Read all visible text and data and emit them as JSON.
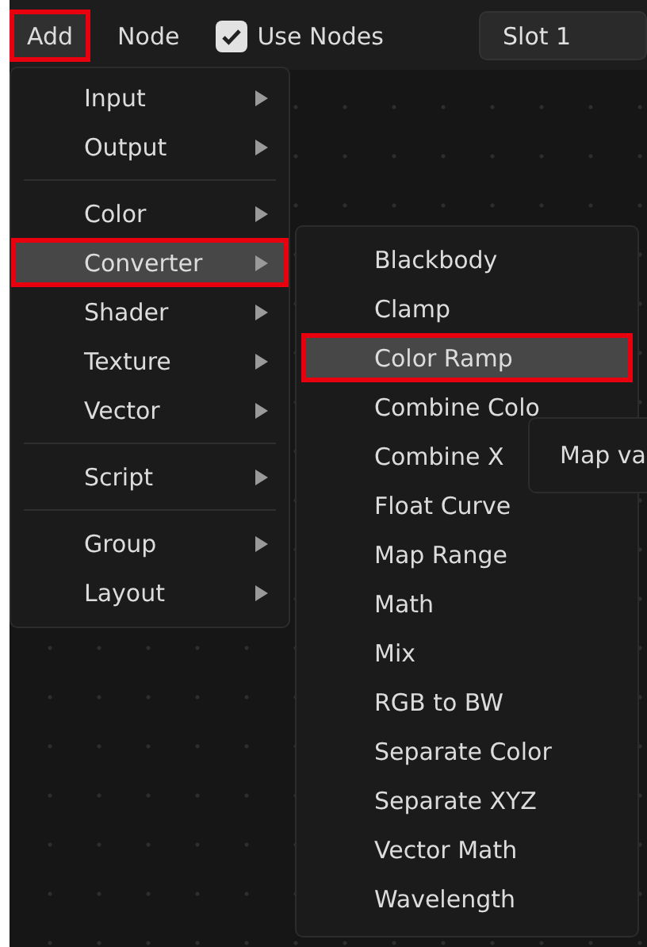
{
  "header": {
    "menus": [
      {
        "label": "Add",
        "selected": true,
        "highlighted": true
      },
      {
        "label": "Node",
        "selected": false,
        "highlighted": false
      }
    ],
    "use_nodes": {
      "label": "Use Nodes",
      "checked": true
    },
    "slot": {
      "value": "Slot 1"
    }
  },
  "add_menu": {
    "items": [
      {
        "kind": "submenu",
        "label": "Input",
        "selected": false,
        "highlighted": false
      },
      {
        "kind": "submenu",
        "label": "Output",
        "selected": false,
        "highlighted": false
      },
      {
        "kind": "separator"
      },
      {
        "kind": "submenu",
        "label": "Color",
        "selected": false,
        "highlighted": false
      },
      {
        "kind": "submenu",
        "label": "Converter",
        "selected": true,
        "highlighted": true
      },
      {
        "kind": "submenu",
        "label": "Shader",
        "selected": false,
        "highlighted": false
      },
      {
        "kind": "submenu",
        "label": "Texture",
        "selected": false,
        "highlighted": false
      },
      {
        "kind": "submenu",
        "label": "Vector",
        "selected": false,
        "highlighted": false
      },
      {
        "kind": "separator"
      },
      {
        "kind": "submenu",
        "label": "Script",
        "selected": false,
        "highlighted": false
      },
      {
        "kind": "separator"
      },
      {
        "kind": "submenu",
        "label": "Group",
        "selected": false,
        "highlighted": false
      },
      {
        "kind": "submenu",
        "label": "Layout",
        "selected": false,
        "highlighted": false
      }
    ]
  },
  "converter_menu": {
    "items": [
      {
        "kind": "item",
        "label": "Blackbody",
        "selected": false,
        "highlighted": false
      },
      {
        "kind": "item",
        "label": "Clamp",
        "selected": false,
        "highlighted": false
      },
      {
        "kind": "item",
        "label": "Color Ramp",
        "selected": true,
        "highlighted": true
      },
      {
        "kind": "item",
        "label": "Combine Colo",
        "selected": false,
        "highlighted": false
      },
      {
        "kind": "item",
        "label": "Combine X",
        "selected": false,
        "highlighted": false
      },
      {
        "kind": "item",
        "label": "Float Curve",
        "selected": false,
        "highlighted": false
      },
      {
        "kind": "item",
        "label": "Map Range",
        "selected": false,
        "highlighted": false
      },
      {
        "kind": "item",
        "label": "Math",
        "selected": false,
        "highlighted": false
      },
      {
        "kind": "item",
        "label": "Mix",
        "selected": false,
        "highlighted": false
      },
      {
        "kind": "item",
        "label": "RGB to BW",
        "selected": false,
        "highlighted": false
      },
      {
        "kind": "item",
        "label": "Separate Color",
        "selected": false,
        "highlighted": false
      },
      {
        "kind": "item",
        "label": "Separate XYZ",
        "selected": false,
        "highlighted": false
      },
      {
        "kind": "item",
        "label": "Vector Math",
        "selected": false,
        "highlighted": false
      },
      {
        "kind": "item",
        "label": "Wavelength",
        "selected": false,
        "highlighted": false
      }
    ]
  },
  "tooltip": {
    "text": "Map va"
  }
}
